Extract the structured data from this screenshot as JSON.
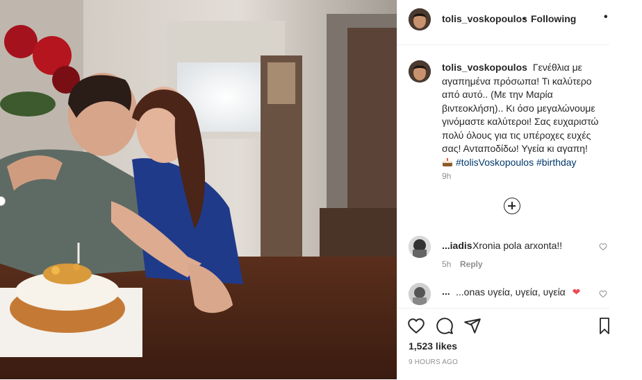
{
  "post": {
    "username": "tolis_voskopoulos",
    "separator": "•",
    "follow_status": "Following",
    "more": "•"
  },
  "caption": {
    "username": "tolis_voskopoulos",
    "text": "Γενέθλια με αγαπημένα πρόσωπα! Τι καλύτερο από αυτό.. (Με την Μαρία βιντεοκλήση).. Κι όσο μεγαλώνουμε γινόμαστε καλύτεροι! Σας ευχαριστώ πολύ όλους για τις υπέροχες ευχές σας! Ανταποδίδω! Υγεία κι αγαπη!",
    "hashtags": [
      "#tolisVoskopoulos",
      "#birthday"
    ],
    "time": "9h"
  },
  "comments": [
    {
      "username": "...iadis",
      "text": "Xronia pola arxonta!!",
      "time": "5h",
      "reply_label": "Reply"
    },
    {
      "username": "...",
      "text": "...onas υγεία, υγεία, υγεία",
      "time": "",
      "reply_label": ""
    }
  ],
  "actions": {
    "icons": [
      "heart-icon",
      "comment-icon",
      "share-icon",
      "bookmark-icon"
    ],
    "likes": "1,523 likes",
    "time_ago": "9 HOURS AGO"
  },
  "colors": {
    "hashtag": "#00376b",
    "muted": "#8e8e8e",
    "text": "#262626",
    "heart": "#ed4956"
  }
}
